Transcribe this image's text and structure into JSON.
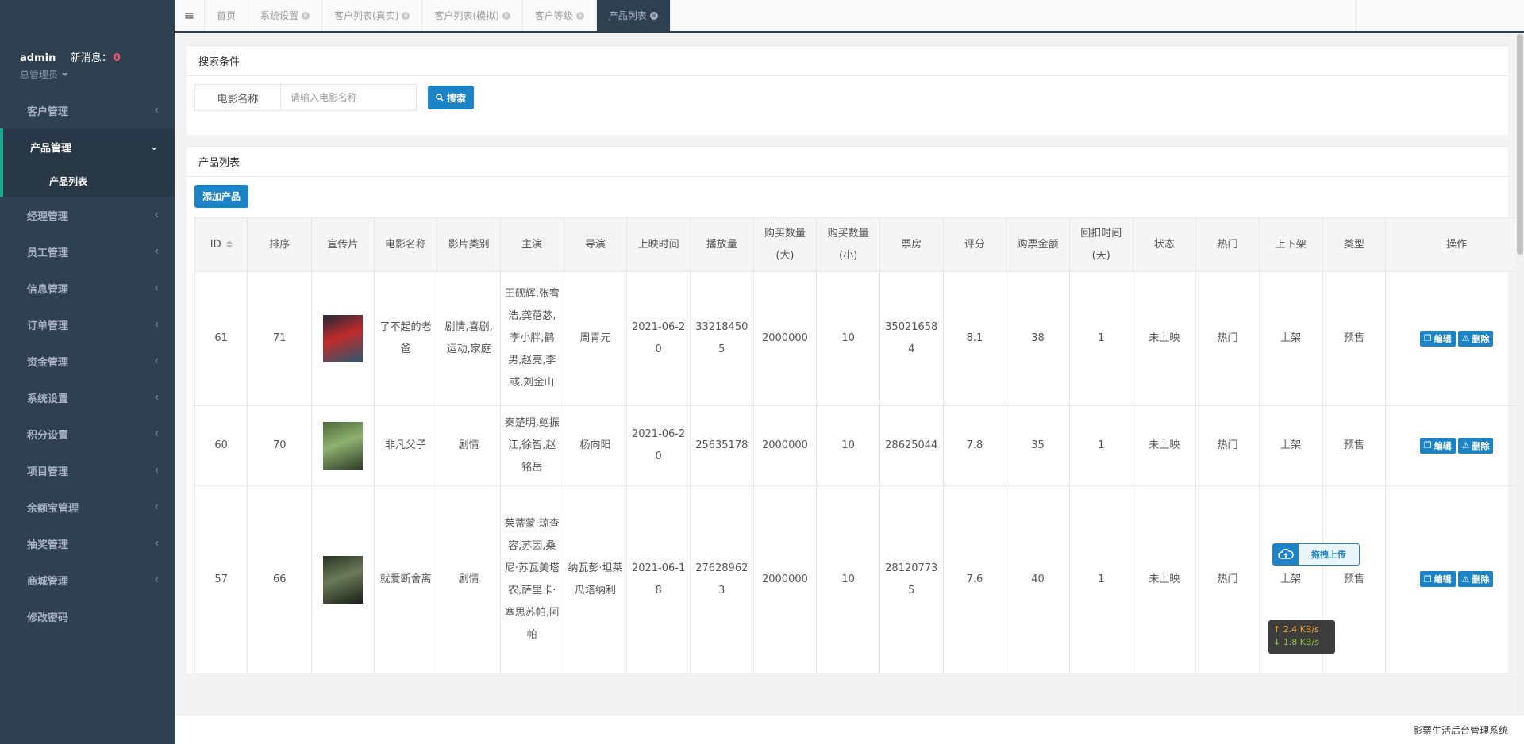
{
  "sidebar": {
    "user": "admin",
    "new_msg_label": "新消息：",
    "new_msg_count": "0",
    "role": "总管理员",
    "menu": [
      {
        "label": "客户管理"
      },
      {
        "label": "产品管理",
        "active": true,
        "sub": [
          "产品列表"
        ]
      },
      {
        "label": "经理管理"
      },
      {
        "label": "员工管理"
      },
      {
        "label": "信息管理"
      },
      {
        "label": "订单管理"
      },
      {
        "label": "资金管理"
      },
      {
        "label": "系统设置"
      },
      {
        "label": "积分设置"
      },
      {
        "label": "项目管理"
      },
      {
        "label": "余额宝管理"
      },
      {
        "label": "抽奖管理"
      },
      {
        "label": "商城管理"
      },
      {
        "label": "修改密码"
      }
    ]
  },
  "tabs": [
    "首页",
    "系统设置",
    "客户列表(真实)",
    "客户列表(模拟)",
    "客户等级",
    "产品列表"
  ],
  "search": {
    "title": "搜索条件",
    "field_label": "电影名称",
    "placeholder": "请输入电影名称",
    "button": "搜索"
  },
  "list": {
    "title": "产品列表",
    "add_button": "添加产品",
    "headers": [
      "ID",
      "排序",
      "宣传片",
      "电影名称",
      "影片类别",
      "主演",
      "导演",
      "上映时间",
      "播放量",
      "购买数量(大)",
      "购买数量(小)",
      "票房",
      "评分",
      "购票金额",
      "回扣时间(天)",
      "状态",
      "热门",
      "上下架",
      "类型",
      "操作"
    ],
    "edit_label": "编辑",
    "delete_label": "删除",
    "rows": [
      {
        "id": "61",
        "sort": "71",
        "name": "了不起的老爸",
        "category": "剧情,喜剧,运动,家庭",
        "cast": "王砚辉,张宥浩,龚蓓苾,李小胖,鹳男,赵亮,李彧,刘金山",
        "director": "周青元",
        "date": "2021-06-20",
        "plays": "332184505",
        "buy_big": "2000000",
        "buy_small": "10",
        "box": "350216584",
        "score": "8.1",
        "price": "38",
        "rebate": "1",
        "status": "未上映",
        "hot": "热门",
        "shelf": "上架",
        "type": "预售",
        "poster_colors": [
          "#1d2a38",
          "#c02a2a",
          "#2a5a70"
        ]
      },
      {
        "id": "60",
        "sort": "70",
        "name": "非凡父子",
        "category": "剧情",
        "cast": "秦楚明,鲍振江,徐智,赵铭岳",
        "director": "杨向阳",
        "date": "2021-06-20",
        "plays": "25635178",
        "buy_big": "2000000",
        "buy_small": "10",
        "box": "28625044",
        "score": "7.8",
        "price": "35",
        "rebate": "1",
        "status": "未上映",
        "hot": "热门",
        "shelf": "上架",
        "type": "预售",
        "poster_colors": [
          "#4d6a3a",
          "#8fb070",
          "#2e3d28"
        ]
      },
      {
        "id": "57",
        "sort": "66",
        "name": "就爱断舍离",
        "category": "剧情",
        "cast": "茱蒂蒙·琼查容,苏因,桑尼·苏瓦美塔农,萨里卡·塞思苏帕,阿帕",
        "director": "纳瓦彭·坦莱瓜塔纳利",
        "date": "2021-06-18",
        "plays": "276289623",
        "buy_big": "2000000",
        "buy_small": "10",
        "box": "281207735",
        "score": "7.6",
        "price": "40",
        "rebate": "1",
        "status": "未上映",
        "hot": "热门",
        "shelf": "上架",
        "type": "预售",
        "poster_colors": [
          "#2c3324",
          "#6a7a58",
          "#1a1f16"
        ]
      }
    ]
  },
  "upload_widget": {
    "label": "拖拽上传"
  },
  "speed": {
    "up": "2.4 KB/s",
    "down": "1.8 KB/s"
  },
  "footer": "影票生活后台管理系统"
}
